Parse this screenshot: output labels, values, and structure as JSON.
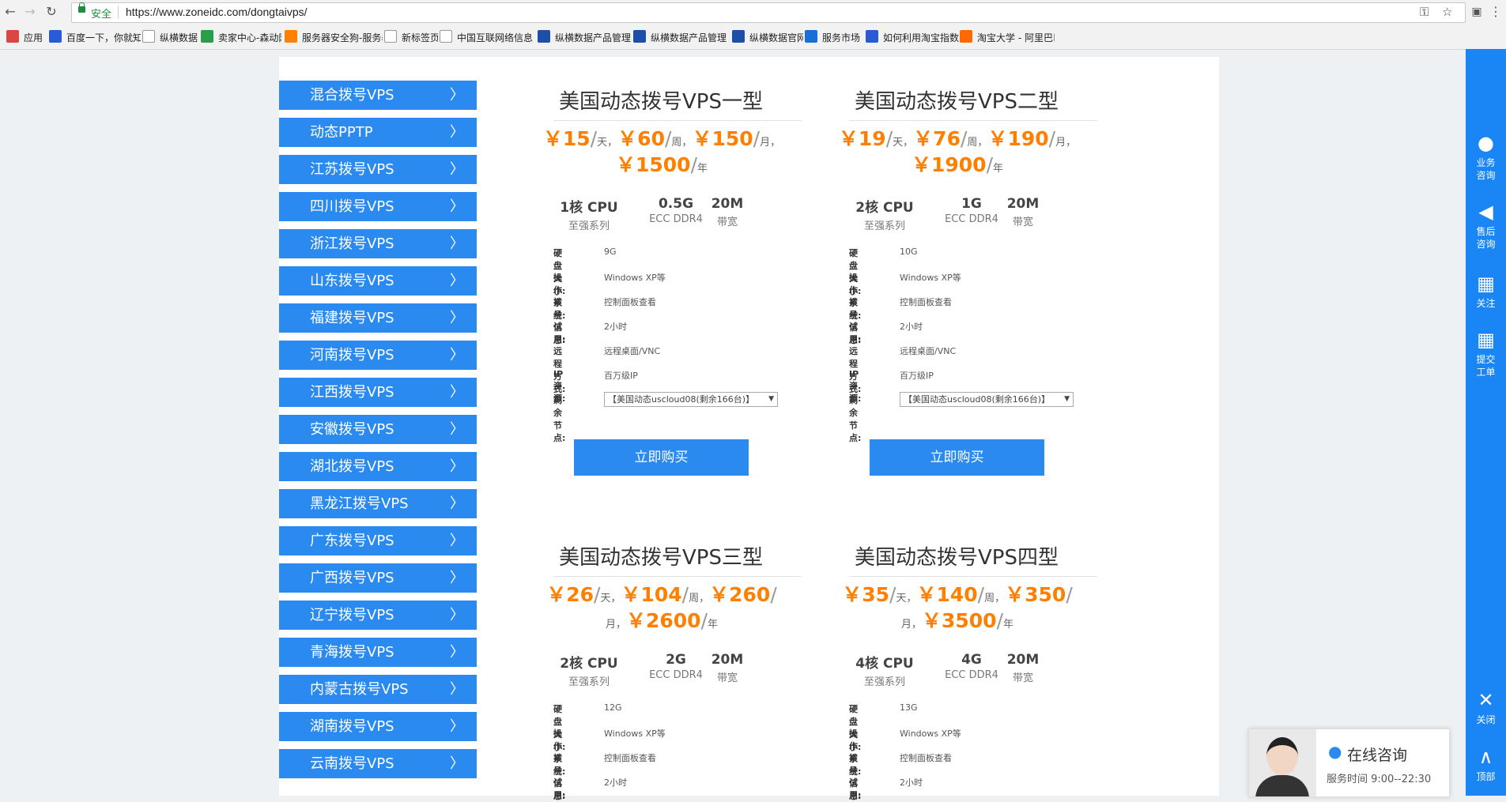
{
  "browser": {
    "secure_label": "安全",
    "url": "https://www.zoneidc.com/dongtaivps/",
    "bookmarks": [
      {
        "label": "应用",
        "icon": "apps-grid-icon",
        "color": "#d44"
      },
      {
        "label": "百度一下，你就知道",
        "icon": "baidu-paw-icon",
        "color": "#2a5bd7"
      },
      {
        "label": "纵横数据",
        "icon": "page-icon",
        "color": "#ffffff"
      },
      {
        "label": "卖家中心-森动网",
        "icon": "site-icon",
        "color": "#2a9d4a"
      },
      {
        "label": "服务器安全狗-服务器",
        "icon": "dog-icon",
        "color": "#ff7f00"
      },
      {
        "label": "新标签页",
        "icon": "page-icon",
        "color": "#ffffff"
      },
      {
        "label": "中国互联网络信息中",
        "icon": "site-icon",
        "color": "#ffffff"
      },
      {
        "label": "纵横数据产品管理平",
        "icon": "cloud-icon",
        "color": "#1e4fa8"
      },
      {
        "label": "纵横数据产品管理平",
        "icon": "cloud-icon",
        "color": "#1e4fa8"
      },
      {
        "label": "纵横数据官网",
        "icon": "cloud-icon",
        "color": "#1e4fa8"
      },
      {
        "label": "服务市场",
        "icon": "site-icon",
        "color": "#1a6fd6"
      },
      {
        "label": "如何利用淘宝指数进",
        "icon": "baidu-paw-icon",
        "color": "#2a5bd7"
      },
      {
        "label": "淘宝大学 - 阿里巴巴",
        "icon": "taobao-icon",
        "color": "#ff6a00"
      }
    ]
  },
  "sidebar": {
    "items": [
      {
        "label": "混合拨号VPS"
      },
      {
        "label": "动态PPTP"
      },
      {
        "label": "江苏拨号VPS"
      },
      {
        "label": "四川拨号VPS"
      },
      {
        "label": "浙江拨号VPS"
      },
      {
        "label": "山东拨号VPS"
      },
      {
        "label": "福建拨号VPS"
      },
      {
        "label": "河南拨号VPS"
      },
      {
        "label": "江西拨号VPS"
      },
      {
        "label": "安徽拨号VPS"
      },
      {
        "label": "湖北拨号VPS"
      },
      {
        "label": "黑龙江拨号VPS"
      },
      {
        "label": "广东拨号VPS"
      },
      {
        "label": "广西拨号VPS"
      },
      {
        "label": "辽宁拨号VPS"
      },
      {
        "label": "青海拨号VPS"
      },
      {
        "label": "内蒙古拨号VPS"
      },
      {
        "label": "湖南拨号VPS"
      },
      {
        "label": "云南拨号VPS"
      }
    ]
  },
  "products": [
    {
      "title": "美国动态拨号VPS一型",
      "prices": {
        "day": "￥15",
        "week": "￥60",
        "month": "￥150",
        "year": "￥1500"
      },
      "units": {
        "day": "天",
        "week": "周",
        "month": "月",
        "year": "年"
      },
      "specs": [
        {
          "value": "1核 CPU",
          "sub": "至强系列"
        },
        {
          "value": "0.5G",
          "sub": "ECC DDR4"
        },
        {
          "value": "20M",
          "sub": "带宽"
        }
      ],
      "details": [
        {
          "key": "硬盘大小:",
          "value": "9G"
        },
        {
          "key": "操作系统:",
          "value": "Windows XP等"
        },
        {
          "key": "拨号信息:",
          "value": "控制面板查看"
        },
        {
          "key": "试用:",
          "value": "2小时"
        },
        {
          "key": "远程方式:",
          "value": "远程桌面/VNC"
        },
        {
          "key": "IP资源:",
          "value": "百万级IP"
        }
      ],
      "node_label": "剩余节点:",
      "node_value": "【美国动态uscloud08(剩余166台)】",
      "buy_label": "立即购买"
    },
    {
      "title": "美国动态拨号VPS二型",
      "prices": {
        "day": "￥19",
        "week": "￥76",
        "month": "￥190",
        "year": "￥1900"
      },
      "units": {
        "day": "天",
        "week": "周",
        "month": "月",
        "year": "年"
      },
      "specs": [
        {
          "value": "2核 CPU",
          "sub": "至强系列"
        },
        {
          "value": "1G",
          "sub": "ECC DDR4"
        },
        {
          "value": "20M",
          "sub": "带宽"
        }
      ],
      "details": [
        {
          "key": "硬盘大小:",
          "value": "10G"
        },
        {
          "key": "操作系统:",
          "value": "Windows XP等"
        },
        {
          "key": "拨号信息:",
          "value": "控制面板查看"
        },
        {
          "key": "试用:",
          "value": "2小时"
        },
        {
          "key": "远程方式:",
          "value": "远程桌面/VNC"
        },
        {
          "key": "IP资源:",
          "value": "百万级IP"
        }
      ],
      "node_label": "剩余节点:",
      "node_value": "【美国动态uscloud08(剩余166台)】",
      "buy_label": "立即购买"
    },
    {
      "title": "美国动态拨号VPS三型",
      "prices": {
        "day": "￥26",
        "week": "￥104",
        "month": "￥260",
        "year": "￥2600"
      },
      "units": {
        "day": "天",
        "week": "周",
        "month": "月",
        "year": "年"
      },
      "specs": [
        {
          "value": "2核 CPU",
          "sub": "至强系列"
        },
        {
          "value": "2G",
          "sub": "ECC DDR4"
        },
        {
          "value": "20M",
          "sub": "带宽"
        }
      ],
      "details": [
        {
          "key": "硬盘大小:",
          "value": "12G"
        },
        {
          "key": "操作系统:",
          "value": "Windows XP等"
        },
        {
          "key": "拨号信息:",
          "value": "控制面板查看"
        },
        {
          "key": "试用:",
          "value": "2小时"
        }
      ]
    },
    {
      "title": "美国动态拨号VPS四型",
      "prices": {
        "day": "￥35",
        "week": "￥140",
        "month": "￥350",
        "year": "￥3500"
      },
      "units": {
        "day": "天",
        "week": "周",
        "month": "月",
        "year": "年"
      },
      "specs": [
        {
          "value": "4核 CPU",
          "sub": "至强系列"
        },
        {
          "value": "4G",
          "sub": "ECC DDR4"
        },
        {
          "value": "20M",
          "sub": "带宽"
        }
      ],
      "details": [
        {
          "key": "硬盘大小:",
          "value": "13G"
        },
        {
          "key": "操作系统:",
          "value": "Windows XP等"
        },
        {
          "key": "拨号信息:",
          "value": "控制面板查看"
        },
        {
          "key": "试用:",
          "value": "2小时"
        }
      ]
    }
  ],
  "right_toolbar": {
    "items": [
      {
        "label_1": "业务",
        "label_2": "咨询",
        "icon": "qq-icon"
      },
      {
        "label_1": "售后",
        "label_2": "咨询",
        "icon": "megaphone-icon"
      },
      {
        "label_1": "关注",
        "label_2": "",
        "icon": "qrcode-icon"
      },
      {
        "label_1": "提交",
        "label_2": "工单",
        "icon": "qrcode-icon"
      },
      {
        "label_1": "关闭",
        "label_2": "",
        "icon": "close-icon"
      },
      {
        "label_1": "顶部",
        "label_2": "",
        "icon": "chevron-up-icon"
      }
    ],
    "color": "#1a86f5"
  },
  "chat": {
    "title": "在线咨询",
    "hours": "服务时间 9:00--22:30"
  },
  "colors": {
    "accent": "#2a8af0",
    "price": "#ff7f00"
  }
}
